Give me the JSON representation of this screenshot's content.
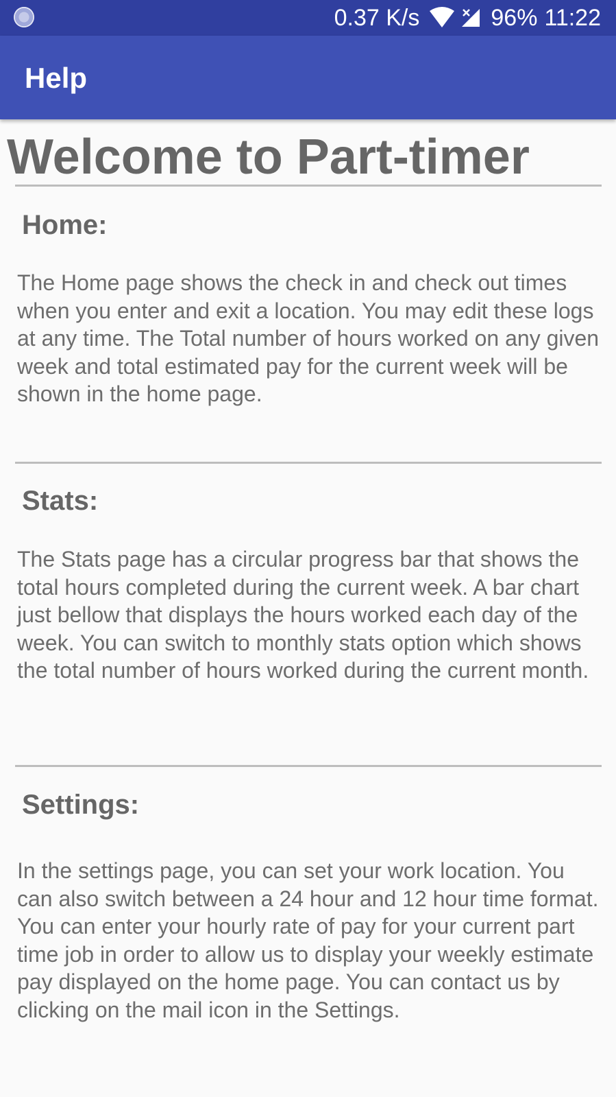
{
  "status_bar": {
    "net_speed": "0.37 K/s",
    "battery": "96%",
    "time": "11:22",
    "icons": [
      "notification-icon",
      "wifi-icon",
      "signal-icon"
    ]
  },
  "app_bar": {
    "title": "Help",
    "color": "#3f51b5",
    "status_color": "#303f9f"
  },
  "page": {
    "heading": "Welcome to Part-timer",
    "sections": [
      {
        "title": "Home:",
        "body": " The Home page shows the check in and check out times   when you enter and exit a location. You may edit these logs at any time. The Total number of hours worked on any given week and total estimated pay for the current week will be shown in the home page."
      },
      {
        "title": "Stats:",
        "body": " The Stats page has a circular progress bar that shows the total hours completed during the current week. A bar chart just bellow that displays the hours worked each day of the week. You can switch to monthly stats option which shows the total number of hours worked during the current month."
      },
      {
        "title": "Settings:",
        "body": " In the settings page, you can set your work location. You can also switch between a 24 hour and 12 hour time format. You can enter your hourly rate of pay for your current part time job in order to allow us to display your weekly estimate pay displayed on the home page. You can contact us by clicking on the mail icon in the Settings."
      }
    ]
  }
}
